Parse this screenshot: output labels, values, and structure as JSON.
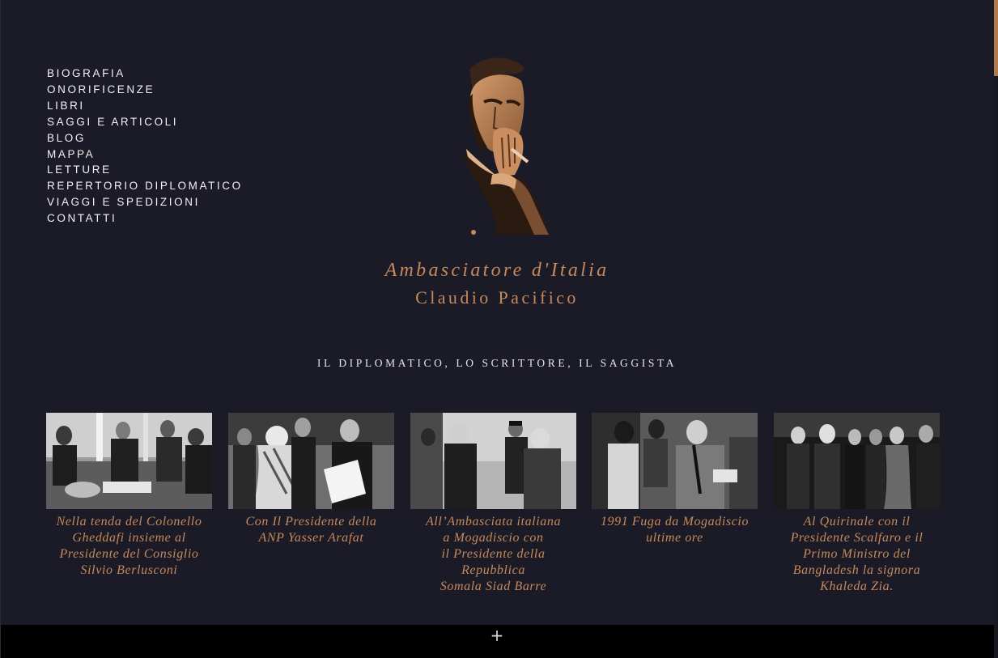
{
  "nav": {
    "items": [
      {
        "label": "BIOGRAFIA"
      },
      {
        "label": "ONORIFICENZE"
      },
      {
        "label": "LIBRI"
      },
      {
        "label": "SAGGI E ARTICOLI"
      },
      {
        "label": "BLOG"
      },
      {
        "label": "MAPPA"
      },
      {
        "label": "LETTURE"
      },
      {
        "label": "REPERTORIO DIPLOMATICO"
      },
      {
        "label": "VIAGGI E SPEDIZIONI"
      },
      {
        "label": "CONTATTI"
      }
    ]
  },
  "header": {
    "title_line1": "Ambasciatore d'Italia",
    "title_line2": "Claudio Pacifico",
    "tagline": "IL DIPLOMATICO, LO SCRITTORE, IL SAGGISTA"
  },
  "gallery": [
    {
      "caption_lines": [
        "Nella tenda del Colonello",
        "Gheddafi insieme al",
        "Presidente del Consiglio",
        "Silvio Berlusconi"
      ]
    },
    {
      "caption_lines": [
        "Con Il Presidente della",
        "ANP Yasser Arafat"
      ]
    },
    {
      "caption_lines": [
        "All’Ambasciata italiana",
        "a Mogadiscio con",
        "il Presidente della",
        "Repubblica",
        "Somala Siad Barre"
      ]
    },
    {
      "caption_lines": [
        "1991 Fuga da Mogadiscio",
        "ultime ore"
      ]
    },
    {
      "caption_lines": [
        "Al Quirinale con il",
        "Presidente Scalfaro e il",
        "Primo Ministro del",
        "Bangladesh la signora",
        "Khaleda Zia."
      ]
    }
  ],
  "footer": {
    "expand_symbol": "+"
  },
  "colors": {
    "background": "#1b1b27",
    "accent": "#c7895a",
    "footer": "#000000"
  },
  "icons": {
    "expand": "plus-icon"
  }
}
